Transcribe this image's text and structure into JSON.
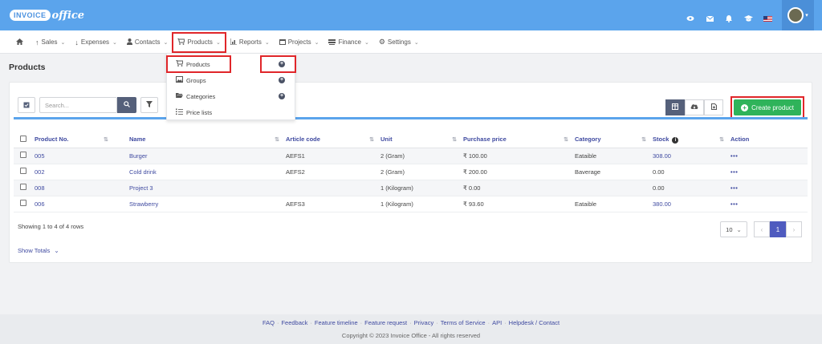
{
  "brand": {
    "part1": "INVOICE",
    "part2": "office"
  },
  "topbar": {
    "icons": [
      "eye-icon",
      "mail-icon",
      "bell-icon",
      "graduation-cap-icon",
      "us-flag-icon"
    ]
  },
  "nav": [
    {
      "label": "",
      "icon": "home-icon"
    },
    {
      "label": "Sales",
      "icon": "arrow-up-icon"
    },
    {
      "label": "Expenses",
      "icon": "arrow-down-icon"
    },
    {
      "label": "Contacts",
      "icon": "user-icon"
    },
    {
      "label": "Products",
      "icon": "cart-icon"
    },
    {
      "label": "Reports",
      "icon": "chart-icon"
    },
    {
      "label": "Projects",
      "icon": "calendar-icon"
    },
    {
      "label": "Finance",
      "icon": "money-icon"
    },
    {
      "label": "Settings",
      "icon": "gear-icon"
    }
  ],
  "page": {
    "title": "Products"
  },
  "search": {
    "placeholder": "Search..."
  },
  "create_button": {
    "label": "Create product"
  },
  "dropdown": [
    {
      "label": "Products",
      "has_add": true
    },
    {
      "label": "Groups",
      "has_add": true
    },
    {
      "label": "Categories",
      "has_add": true
    },
    {
      "label": "Price lists",
      "has_add": false
    }
  ],
  "table": {
    "headers": [
      "Product No.",
      "Name",
      "Article code",
      "Unit",
      "Purchase price",
      "Category",
      "Stock",
      "Action"
    ],
    "rows": [
      {
        "no": "005",
        "name": "Burger",
        "code": "AEFS1",
        "unit": "2 (Gram)",
        "price": "₹ 100.00",
        "category": "Eataible",
        "stock": "308.00",
        "stock_link": true
      },
      {
        "no": "002",
        "name": "Cold drink",
        "code": "AEFS2",
        "unit": "2 (Gram)",
        "price": "₹ 200.00",
        "category": "Baverage",
        "stock": "0.00",
        "stock_link": false
      },
      {
        "no": "008",
        "name": "Project 3",
        "code": "",
        "unit": "1 (Kilogram)",
        "price": "₹ 0.00",
        "category": "",
        "stock": "0.00",
        "stock_link": false
      },
      {
        "no": "006",
        "name": "Strawberry",
        "code": "AEFS3",
        "unit": "1 (Kilogram)",
        "price": "₹ 93.60",
        "category": "Eataible",
        "stock": "380.00",
        "stock_link": true
      }
    ],
    "action_label": "•••"
  },
  "showing": "Showing 1 to 4 of 4 rows",
  "show_totals": "Show Totals",
  "pagination": {
    "page_size": "10",
    "prev": "‹",
    "current": "1",
    "next": "›"
  },
  "footer": {
    "links": [
      "FAQ",
      "Feedback",
      "Feature timeline",
      "Feature request",
      "Privacy",
      "Terms of Service",
      "API",
      "Helpdesk / Contact"
    ],
    "copyright": "Copyright © 2023 Invoice Office - All rights reserved"
  }
}
